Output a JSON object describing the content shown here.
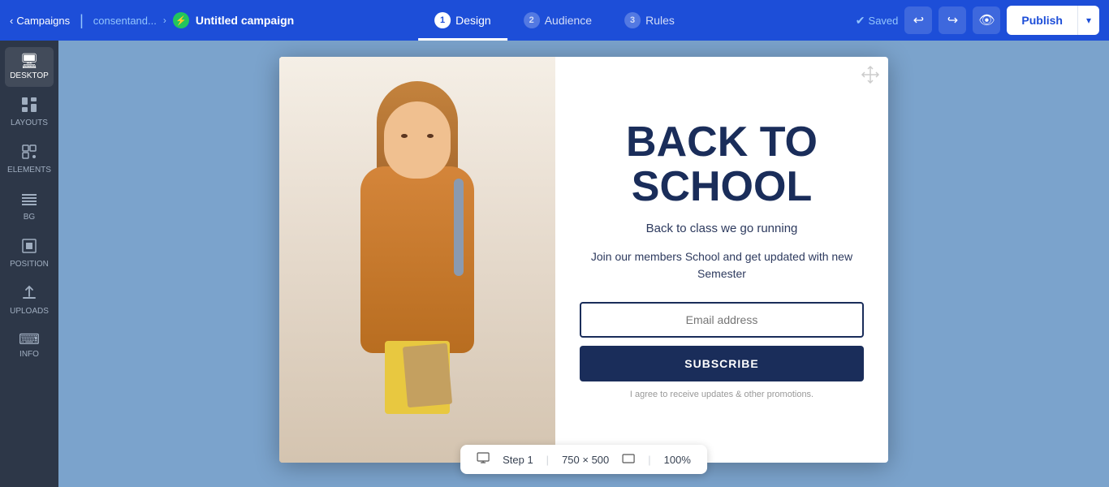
{
  "nav": {
    "back_label": "Campaigns",
    "breadcrumb": "consentand...",
    "campaign_title": "Untitled campaign",
    "tabs": [
      {
        "num": "1",
        "label": "Design",
        "active": true
      },
      {
        "num": "2",
        "label": "Audience",
        "active": false
      },
      {
        "num": "3",
        "label": "Rules",
        "active": false
      }
    ],
    "saved_label": "Saved",
    "publish_label": "Publish"
  },
  "sidebar": {
    "items": [
      {
        "id": "desktop",
        "icon": "🖥",
        "label": "DESKTOP"
      },
      {
        "id": "layouts",
        "icon": "▦",
        "label": "LAYOUTS"
      },
      {
        "id": "elements",
        "icon": "◱",
        "label": "ELEMENTS"
      },
      {
        "id": "bg",
        "icon": "▤",
        "label": "BG"
      },
      {
        "id": "position",
        "icon": "⊡",
        "label": "POSITION"
      },
      {
        "id": "uploads",
        "icon": "⬆",
        "label": "UPLOADS"
      },
      {
        "id": "info",
        "icon": "⌨",
        "label": "INFO"
      }
    ]
  },
  "popup": {
    "big_title_line1": "BACK TO",
    "big_title_line2": "SCHOOL",
    "subtitle": "Back to class we go running",
    "description": "Join our members School and get updated with new Semester",
    "email_placeholder": "Email address",
    "subscribe_label": "SUBSCRIBE",
    "consent_label": "I agree to receive updates & other promotions."
  },
  "bottom_bar": {
    "step_label": "Step 1",
    "dimensions": "750 × 500",
    "zoom": "100%"
  }
}
